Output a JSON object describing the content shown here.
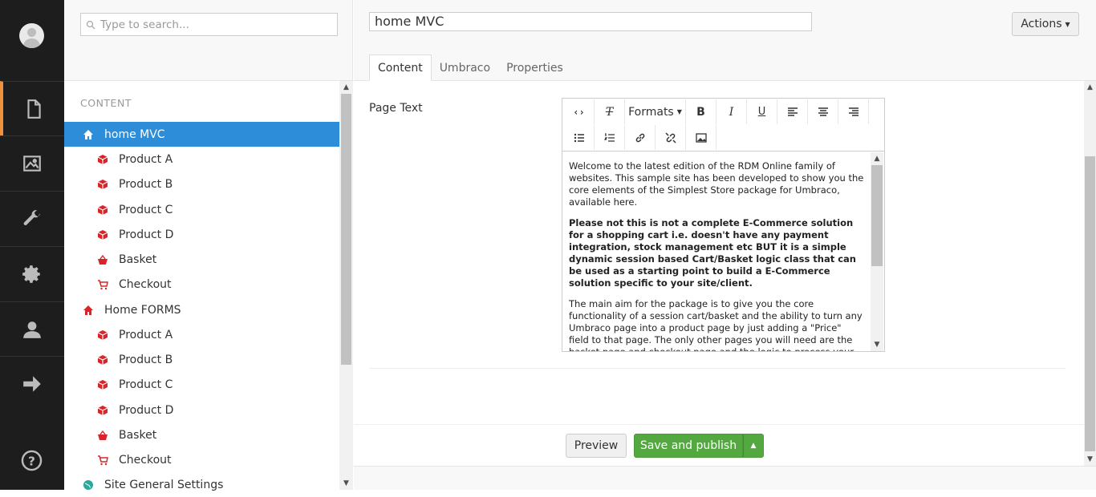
{
  "nav": {
    "sections": [
      "content-icon",
      "media-icon",
      "developer-wrench-icon",
      "settings-gear-icon",
      "members-icon",
      "forms-arrow-icon"
    ],
    "help_icon": "help-icon",
    "accent": "#f0923c"
  },
  "tree": {
    "search_placeholder": "Type to search...",
    "section_title": "CONTENT",
    "nodes": [
      {
        "label": "home MVC",
        "icon": "home-icon",
        "level": 0,
        "selected": true
      },
      {
        "label": "Product A",
        "icon": "product-box-icon",
        "level": 1
      },
      {
        "label": "Product B",
        "icon": "product-box-icon",
        "level": 1
      },
      {
        "label": "Product C",
        "icon": "product-box-icon",
        "level": 1
      },
      {
        "label": "Product D",
        "icon": "product-box-icon",
        "level": 1
      },
      {
        "label": "Basket",
        "icon": "basket-icon",
        "level": 1
      },
      {
        "label": "Checkout",
        "icon": "cart-icon",
        "level": 1
      },
      {
        "label": "Home FORMS",
        "icon": "home-icon",
        "level": 0
      },
      {
        "label": "Product A",
        "icon": "product-box-icon",
        "level": 1
      },
      {
        "label": "Product B",
        "icon": "product-box-icon",
        "level": 1
      },
      {
        "label": "Product C",
        "icon": "product-box-icon",
        "level": 1
      },
      {
        "label": "Product D",
        "icon": "product-box-icon",
        "level": 1
      },
      {
        "label": "Basket",
        "icon": "basket-icon",
        "level": 1
      },
      {
        "label": "Checkout",
        "icon": "cart-icon",
        "level": 1
      },
      {
        "label": "Site General Settings",
        "icon": "globe-icon",
        "level": 0
      }
    ],
    "selected_color": "#2e8dd8",
    "icon_color": "#d9252a"
  },
  "editor": {
    "name": "home MVC",
    "actions_label": "Actions",
    "tabs": [
      "Content",
      "Umbraco",
      "Properties"
    ],
    "active_tab": "Content",
    "property_label": "Page Text",
    "toolbar": {
      "formats_label": "Formats"
    },
    "body": {
      "p1": "Welcome to the latest edition of the RDM Online family of websites. This sample site has been developed to show you the core elements of the Simplest Store package for Umbraco, available here.",
      "p2": "Please not this is not a complete E-Commerce solution for a shopping cart i.e. doesn't have any payment integration, stock management etc BUT it is a simple dynamic session based Cart/Basket logic class that can be used as a starting point to build a E-Commerce solution specific to your site/client.",
      "p3": "The main aim for the package is to give you the core functionality of a session cart/basket and the ability to turn any Umbraco page into a product page by just adding a \"Price\" field to that page. The only other pages you will need are the basket page and checkout page and the logic to process your"
    },
    "preview_label": "Preview",
    "publish_label": "Save and publish",
    "publish_color": "#53a93f"
  }
}
